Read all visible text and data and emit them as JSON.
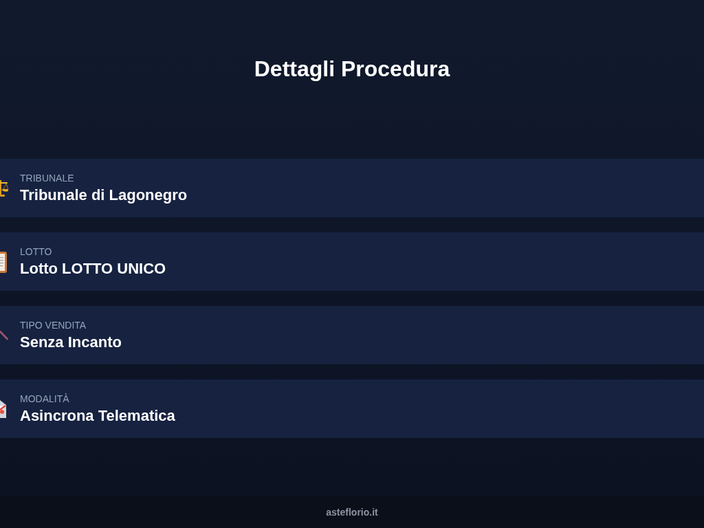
{
  "page": {
    "title": "Dettagli Procedura"
  },
  "details": [
    {
      "label": "TRIBUNALE",
      "value": "Tribunale di Lagonegro"
    },
    {
      "label": "LOTTO",
      "value": "Lotto LOTTO UNICO"
    },
    {
      "label": "TIPO VENDITA",
      "value": "Senza Incanto"
    },
    {
      "label": "MODALITÀ",
      "value": "Asincrona Telematica"
    }
  ],
  "footer": {
    "text": "asteflorio.it"
  }
}
